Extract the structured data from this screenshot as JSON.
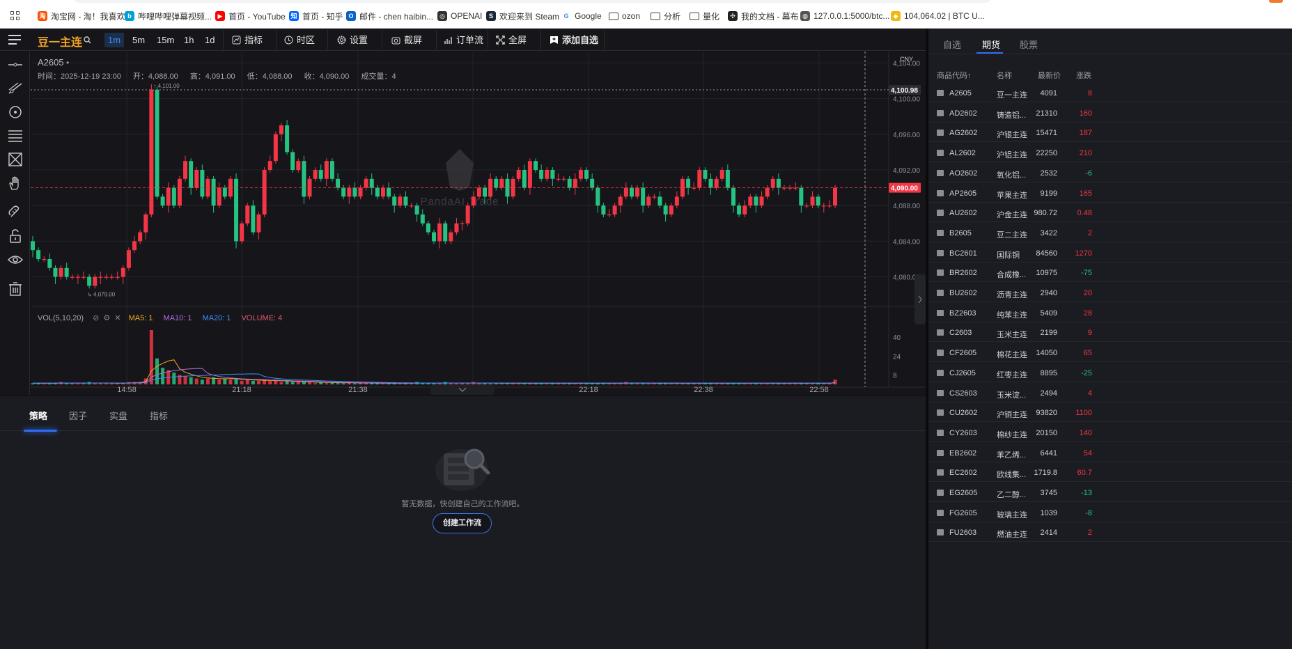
{
  "bookmarks": [
    {
      "label": "淘宝网 - 淘！我喜欢",
      "icon": "taobao-icon",
      "color": "#ff5000",
      "glyph": "淘"
    },
    {
      "label": "哔哩哔哩弹幕视频...",
      "icon": "bilibili-icon",
      "color": "#00a1d6",
      "glyph": "b"
    },
    {
      "label": "首页 - YouTube",
      "icon": "youtube-icon",
      "color": "#ff0000",
      "glyph": "▶"
    },
    {
      "label": "首页 - 知乎",
      "icon": "zhihu-icon",
      "color": "#0066ff",
      "glyph": "知"
    },
    {
      "label": "邮件 - chen haibin...",
      "icon": "outlook-icon",
      "color": "#0a64c8",
      "glyph": "O"
    },
    {
      "label": "OPENAI",
      "icon": "openai-icon",
      "color": "#333333",
      "glyph": "◎"
    },
    {
      "label": "欢迎来到 Steam",
      "icon": "steam-icon",
      "color": "#1b2838",
      "glyph": "S"
    },
    {
      "label": "Google",
      "icon": "google-icon",
      "color": "#ffffff",
      "glyph": "G"
    },
    {
      "label": "ozon",
      "icon": "folder-icon",
      "color": "#ffffff",
      "glyph": ""
    },
    {
      "label": "分析",
      "icon": "folder-icon",
      "color": "#ffffff",
      "glyph": ""
    },
    {
      "label": "量化",
      "icon": "folder-icon",
      "color": "#ffffff",
      "glyph": ""
    },
    {
      "label": "我的文档 - 幕布",
      "icon": "mubu-icon",
      "color": "#222222",
      "glyph": "✣"
    },
    {
      "label": "127.0.0.1:5000/btc...",
      "icon": "globe-icon",
      "color": "#555555",
      "glyph": "◍"
    },
    {
      "label": "104,064.02 | BTC U...",
      "icon": "binance-icon",
      "color": "#f0b90b",
      "glyph": "◆"
    }
  ],
  "toolbar": {
    "title": "豆一主连",
    "search_glyph": "🔍",
    "periods": [
      {
        "label": "1m",
        "active": true
      },
      {
        "label": "5m",
        "active": false
      },
      {
        "label": "15m",
        "active": false
      },
      {
        "label": "1h",
        "active": false
      },
      {
        "label": "1d",
        "active": false
      }
    ],
    "tools": [
      {
        "label": "指标",
        "icon": "indicator-icon"
      },
      {
        "label": "时区",
        "icon": "timezone-icon"
      },
      {
        "label": "设置",
        "icon": "settings-icon"
      },
      {
        "label": "截屏",
        "icon": "camera-icon"
      },
      {
        "label": "订单流",
        "icon": "orderflow-icon"
      },
      {
        "label": "全屏",
        "icon": "fullscreen-icon"
      },
      {
        "label": "添加自选",
        "icon": "bookmark-add-icon"
      }
    ]
  },
  "left_tools": [
    "horizontal-line-icon",
    "trend-line-icon",
    "circle-target-icon",
    "fib-lines-icon",
    "pattern-icon",
    "hand-icon",
    "magnet-icon",
    "lock-icon",
    "eye-icon",
    "trash-icon"
  ],
  "chart": {
    "symbol": "A2605",
    "dot": "•",
    "ohlc": {
      "time": "时间：2025-12-19 23:00",
      "open": "开：4,088.00",
      "high": "高：4,091.00",
      "low": "低：4,088.00",
      "close": "收：4,090.00",
      "volume": "成交量：4"
    },
    "currency": "CNY",
    "watermark": "PandaAI Trade",
    "crosshair_price": "4,100.98",
    "last_price": "4,090.00",
    "high_label": "4,101.00",
    "low_label": "4,079.00",
    "vol": {
      "title": "VOL(5,10,20)",
      "ma5": "MA5: 1",
      "ma10": "MA10: 1",
      "ma20": "MA20: 1",
      "volume": "VOLUME: 4"
    },
    "colors": {
      "up": "#f23645",
      "down": "#26c281",
      "ma5": "#f5a623",
      "ma10": "#b06ee0",
      "ma20": "#3e8ef7",
      "volume_label": "#e05a6e"
    }
  },
  "chart_data": {
    "type": "candlestick",
    "symbol": "A2605",
    "ylim": [
      4077,
      4104.5
    ],
    "yticks": [
      "4,104.00",
      "4,100.00",
      "4,096.00",
      "4,092.00",
      "4,088.00",
      "4,084.00",
      "4,080.00"
    ],
    "ytick_values": [
      4104,
      4100,
      4096,
      4092,
      4088,
      4084,
      4080
    ],
    "xticks": [
      "14:58",
      "21:18",
      "21:38",
      "21:58",
      "22:18",
      "22:38",
      "22:58"
    ],
    "vol_yticks": [
      "40",
      "24",
      "8"
    ],
    "vol_ytick_values": [
      40,
      24,
      8
    ],
    "vol_max": 46,
    "closes": [
      4083,
      4082,
      4082,
      4081,
      4080,
      4081,
      4080,
      4080,
      4080,
      4080,
      4079,
      4080,
      4080,
      4080,
      4080,
      4080,
      4081,
      4083,
      4084,
      4085,
      4087,
      4101,
      4089,
      4088,
      4090,
      4088,
      4091,
      4093,
      4090,
      4092,
      4089,
      4091,
      4088,
      4090,
      4089,
      4091,
      4084,
      4086,
      4088,
      4085,
      4087,
      4092,
      4093,
      4096,
      4097,
      4094,
      4092,
      4093,
      4089,
      4091,
      4092,
      4091,
      4093,
      4091,
      4090,
      4089,
      4090,
      4089,
      4090,
      4091,
      4090,
      4089,
      4090,
      4089,
      4088,
      4089,
      4088,
      4088,
      4087,
      4086,
      4085,
      4084,
      4086,
      4084,
      4085,
      4086,
      4086,
      4088,
      4089,
      4090,
      4089,
      4091,
      4090,
      4091,
      4089,
      4091,
      4092,
      4090,
      4093,
      4092,
      4091,
      4092,
      4091,
      4091,
      4091,
      4090,
      4091,
      4092,
      4091,
      4090,
      4088,
      4087,
      4087,
      4088,
      4089,
      4090,
      4089,
      4090,
      4088,
      4089,
      4089,
      4088,
      4087,
      4088,
      4089,
      4091,
      4090,
      4090,
      4092,
      4091,
      4090,
      4091,
      4092,
      4090,
      4088,
      4087,
      4088,
      4089,
      4088,
      4089,
      4090,
      4091,
      4090,
      4090,
      4090,
      4090,
      4088,
      4088,
      4089,
      4088,
      4088,
      4088,
      4090
    ],
    "opens": [
      4084,
      4083,
      4082,
      4082,
      4081,
      4080,
      4081,
      4080,
      4080,
      4080,
      4080,
      4079,
      4080,
      4080,
      4080,
      4080,
      4080,
      4081,
      4083,
      4084,
      4085,
      4087,
      4101,
      4089,
      4088,
      4090,
      4088,
      4091,
      4093,
      4090,
      4092,
      4089,
      4091,
      4088,
      4090,
      4089,
      4091,
      4084,
      4086,
      4088,
      4085,
      4087,
      4092,
      4093,
      4096,
      4097,
      4094,
      4092,
      4093,
      4089,
      4091,
      4092,
      4091,
      4093,
      4091,
      4090,
      4089,
      4090,
      4089,
      4090,
      4091,
      4090,
      4089,
      4090,
      4089,
      4088,
      4089,
      4088,
      4088,
      4087,
      4086,
      4085,
      4084,
      4086,
      4084,
      4085,
      4086,
      4086,
      4088,
      4089,
      4090,
      4089,
      4091,
      4090,
      4091,
      4089,
      4091,
      4092,
      4090,
      4093,
      4092,
      4091,
      4092,
      4091,
      4091,
      4091,
      4090,
      4091,
      4092,
      4091,
      4090,
      4088,
      4087,
      4087,
      4088,
      4089,
      4090,
      4089,
      4090,
      4088,
      4089,
      4089,
      4088,
      4087,
      4088,
      4089,
      4091,
      4090,
      4090,
      4092,
      4091,
      4090,
      4091,
      4092,
      4090,
      4088,
      4087,
      4088,
      4089,
      4088,
      4089,
      4090,
      4091,
      4090,
      4090,
      4090,
      4090,
      4088,
      4088,
      4089,
      4088,
      4088,
      4088
    ],
    "volumes": [
      1,
      1,
      1,
      1,
      1,
      2,
      1,
      1,
      1,
      1,
      2,
      1,
      1,
      1,
      1,
      1,
      1,
      2,
      2,
      2,
      5,
      46,
      22,
      14,
      12,
      10,
      8,
      7,
      6,
      5,
      4,
      5,
      6,
      4,
      5,
      4,
      5,
      3,
      4,
      3,
      3,
      4,
      3,
      3,
      2,
      3,
      2,
      2,
      2,
      2,
      1,
      2,
      1,
      2,
      1,
      1,
      2,
      1,
      1,
      1,
      1,
      1,
      1,
      1,
      1,
      1,
      1,
      1,
      2,
      1,
      1,
      1,
      1,
      2,
      1,
      1,
      1,
      1,
      2,
      1,
      1,
      1,
      1,
      1,
      1,
      1,
      1,
      1,
      1,
      1,
      1,
      1,
      1,
      1,
      1,
      1,
      1,
      1,
      1,
      1,
      1,
      1,
      1,
      1,
      1,
      2,
      1,
      1,
      1,
      1,
      1,
      1,
      1,
      1,
      1,
      1,
      1,
      1,
      1,
      1,
      1,
      1,
      1,
      1,
      1,
      1,
      1,
      1,
      1,
      1,
      1,
      1,
      1,
      1,
      1,
      1,
      1,
      1,
      1,
      1,
      1,
      1,
      4
    ]
  },
  "bottom": {
    "tabs": [
      {
        "label": "策略",
        "active": true
      },
      {
        "label": "因子",
        "active": false
      },
      {
        "label": "实盘",
        "active": false
      },
      {
        "label": "指标",
        "active": false
      }
    ],
    "empty_text": "暂无数据，快创建自己的工作流吧。",
    "create_button": "创建工作流"
  },
  "right": {
    "tabs": [
      {
        "label": "自选",
        "active": false
      },
      {
        "label": "期货",
        "active": true
      },
      {
        "label": "股票",
        "active": false
      }
    ],
    "headers": {
      "code": "商品代码↑",
      "name": "名称",
      "price": "最新价",
      "change": "涨跌"
    },
    "rows": [
      {
        "code": "A2605",
        "name": "豆一主连",
        "price": "4091",
        "change": "8",
        "dir": "up"
      },
      {
        "code": "AD2602",
        "name": "铸造铝...",
        "price": "21310",
        "change": "160",
        "dir": "up"
      },
      {
        "code": "AG2602",
        "name": "沪银主连",
        "price": "15471",
        "change": "187",
        "dir": "up"
      },
      {
        "code": "AL2602",
        "name": "沪铝主连",
        "price": "22250",
        "change": "210",
        "dir": "up"
      },
      {
        "code": "AO2602",
        "name": "氧化铝...",
        "price": "2532",
        "change": "-6",
        "dir": "dn"
      },
      {
        "code": "AP2605",
        "name": "苹果主连",
        "price": "9199",
        "change": "165",
        "dir": "up"
      },
      {
        "code": "AU2602",
        "name": "沪金主连",
        "price": "980.72",
        "change": "0.48",
        "dir": "up"
      },
      {
        "code": "B2605",
        "name": "豆二主连",
        "price": "3422",
        "change": "2",
        "dir": "up"
      },
      {
        "code": "BC2601",
        "name": "国际铜",
        "price": "84560",
        "change": "1270",
        "dir": "up"
      },
      {
        "code": "BR2602",
        "name": "合成橡...",
        "price": "10975",
        "change": "-75",
        "dir": "dn"
      },
      {
        "code": "BU2602",
        "name": "沥青主连",
        "price": "2940",
        "change": "20",
        "dir": "up"
      },
      {
        "code": "BZ2603",
        "name": "纯苯主连",
        "price": "5409",
        "change": "28",
        "dir": "up"
      },
      {
        "code": "C2603",
        "name": "玉米主连",
        "price": "2199",
        "change": "9",
        "dir": "up"
      },
      {
        "code": "CF2605",
        "name": "棉花主连",
        "price": "14050",
        "change": "65",
        "dir": "up"
      },
      {
        "code": "CJ2605",
        "name": "红枣主连",
        "price": "8895",
        "change": "-25",
        "dir": "dn"
      },
      {
        "code": "CS2603",
        "name": "玉米淀...",
        "price": "2494",
        "change": "4",
        "dir": "up"
      },
      {
        "code": "CU2602",
        "name": "沪铜主连",
        "price": "93820",
        "change": "1100",
        "dir": "up"
      },
      {
        "code": "CY2603",
        "name": "棉纱主连",
        "price": "20150",
        "change": "140",
        "dir": "up"
      },
      {
        "code": "EB2602",
        "name": "苯乙烯...",
        "price": "6441",
        "change": "54",
        "dir": "up"
      },
      {
        "code": "EC2602",
        "name": "欧线集...",
        "price": "1719.8",
        "change": "60.7",
        "dir": "up"
      },
      {
        "code": "EG2605",
        "name": "乙二醇...",
        "price": "3745",
        "change": "-13",
        "dir": "dn"
      },
      {
        "code": "FG2605",
        "name": "玻璃主连",
        "price": "1039",
        "change": "-8",
        "dir": "dn"
      },
      {
        "code": "FU2603",
        "name": "燃油主连",
        "price": "2414",
        "change": "2",
        "dir": "up"
      }
    ]
  }
}
